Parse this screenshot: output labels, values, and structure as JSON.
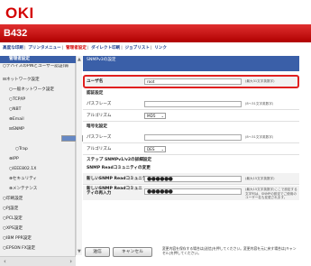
{
  "brand": {
    "logo": "OKI",
    "model": "B432"
  },
  "topnav": {
    "items": [
      "高度な印刷",
      "プリンタメニュー",
      "管理者設定",
      "ダイレクト印刷",
      "ジョブリスト",
      "リンク"
    ],
    "current_index": 2
  },
  "sidebar": {
    "header": "管理者設定",
    "items": [
      "デバイスのPINとユーザー認証(弱",
      "ネットワーク設定",
      "一般ネットワーク設定",
      "TCP/IP",
      "NBT",
      "Email",
      "SNMP",
      "設定",
      "Trap",
      "IPP",
      "IEEE802.1X",
      "セキュリティ",
      "メンテナンス",
      "印刷設定",
      "PJ設定",
      "PCL設定",
      "XPS設定",
      "IBM PPR設定",
      "EPSON FX設定"
    ],
    "selected": "設定"
  },
  "main": {
    "section_title": "SNMPv3の設定",
    "fields": {
      "username_label": "ユーザ名",
      "username_value": "root",
      "username_hint": "(最大31文字英数字)",
      "auth_header": "認証設定",
      "auth_pass_label": "パスフレーズ",
      "auth_pass_hint": "(8～31文字英数字)",
      "auth_algo_label": "アルゴリズム",
      "auth_algo_value": "MD5",
      "enc_header": "暗号化設定",
      "enc_pass_label": "パスフレーズ",
      "enc_pass_hint": "(8～31文字英数字)",
      "enc_algo_label": "アルゴリズム",
      "enc_algo_value": "DES",
      "v1v2_header": "ステップ SNMPv1/v2の詳細設定",
      "read_community_header": "SNMP Readコミュニティの変更",
      "new_community_label": "新しいSNMP Readコミュニティ",
      "new_community_value": "●●●●●●",
      "new_community_hint": "(最大15文字英数字)",
      "confirm_community_label": "新しいSNMP Readコミュニティの再入力",
      "confirm_community_value": "●●●●●●",
      "confirm_community_hint": "(最大15文字英数字)ここで設定する文字列は、SNMPの設定でご使用のユーザー名も変更されます。"
    },
    "buttons": {
      "submit": "送信",
      "cancel": "キャンセル"
    },
    "footer_note": "変更内容を保存する場合は[送信]を押してください。変更内容を元に戻す場合は[キャンセル]を押してください。"
  },
  "colors": {
    "brand_red": "#d40000",
    "nav_blue": "#3a5fa8",
    "highlight": "#e02020"
  }
}
